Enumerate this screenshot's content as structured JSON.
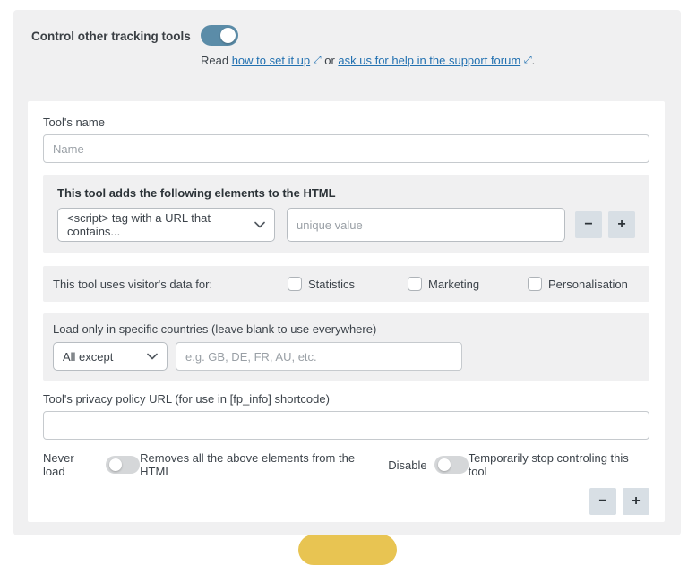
{
  "header": {
    "label": "Control other tracking tools",
    "toggle_on": true,
    "read_prefix": "Read",
    "link_setup": "how to set it up",
    "conjunction": "or",
    "link_support": "ask us for help in the support forum",
    "sentence_end": "."
  },
  "form": {
    "tool_name": {
      "label": "Tool's name",
      "placeholder": "Name",
      "value": ""
    },
    "elements_box": {
      "heading": "This tool adds the following elements to the HTML",
      "select_value": "<script> tag with a URL that contains...",
      "input_placeholder": "unique value",
      "input_value": "",
      "remove_label": "−",
      "add_label": "+"
    },
    "data_usage": {
      "label": "This tool uses visitor's data for:",
      "options": [
        {
          "label": "Statistics",
          "checked": false
        },
        {
          "label": "Marketing",
          "checked": false
        },
        {
          "label": "Personalisation",
          "checked": false
        }
      ]
    },
    "countries": {
      "label": "Load only in specific countries (leave blank to use everywhere)",
      "select_value": "All except",
      "input_placeholder": "e.g. GB, DE, FR, AU, etc.",
      "input_value": ""
    },
    "privacy": {
      "label": "Tool's privacy policy URL (for use in [fp_info] shortcode)",
      "value": ""
    },
    "state_toggles": {
      "never_load_label": "Never load",
      "never_load_on": false,
      "never_load_desc": "Removes all the above elements from the HTML",
      "disable_label": "Disable",
      "disable_on": false,
      "disable_desc": "Temporarily stop controling this tool"
    },
    "row_actions": {
      "remove_label": "−",
      "add_label": "+"
    }
  },
  "icons": {
    "external_link": "external-link",
    "chevron_down": "chevron-down"
  },
  "colors": {
    "toggle_on": "#5b8ca8",
    "toggle_off": "#d5d7d9",
    "panel_bg": "#f0f0f1",
    "link": "#2271b1",
    "square_button_bg": "#d8dfe5",
    "save_button": "#e8c452"
  }
}
